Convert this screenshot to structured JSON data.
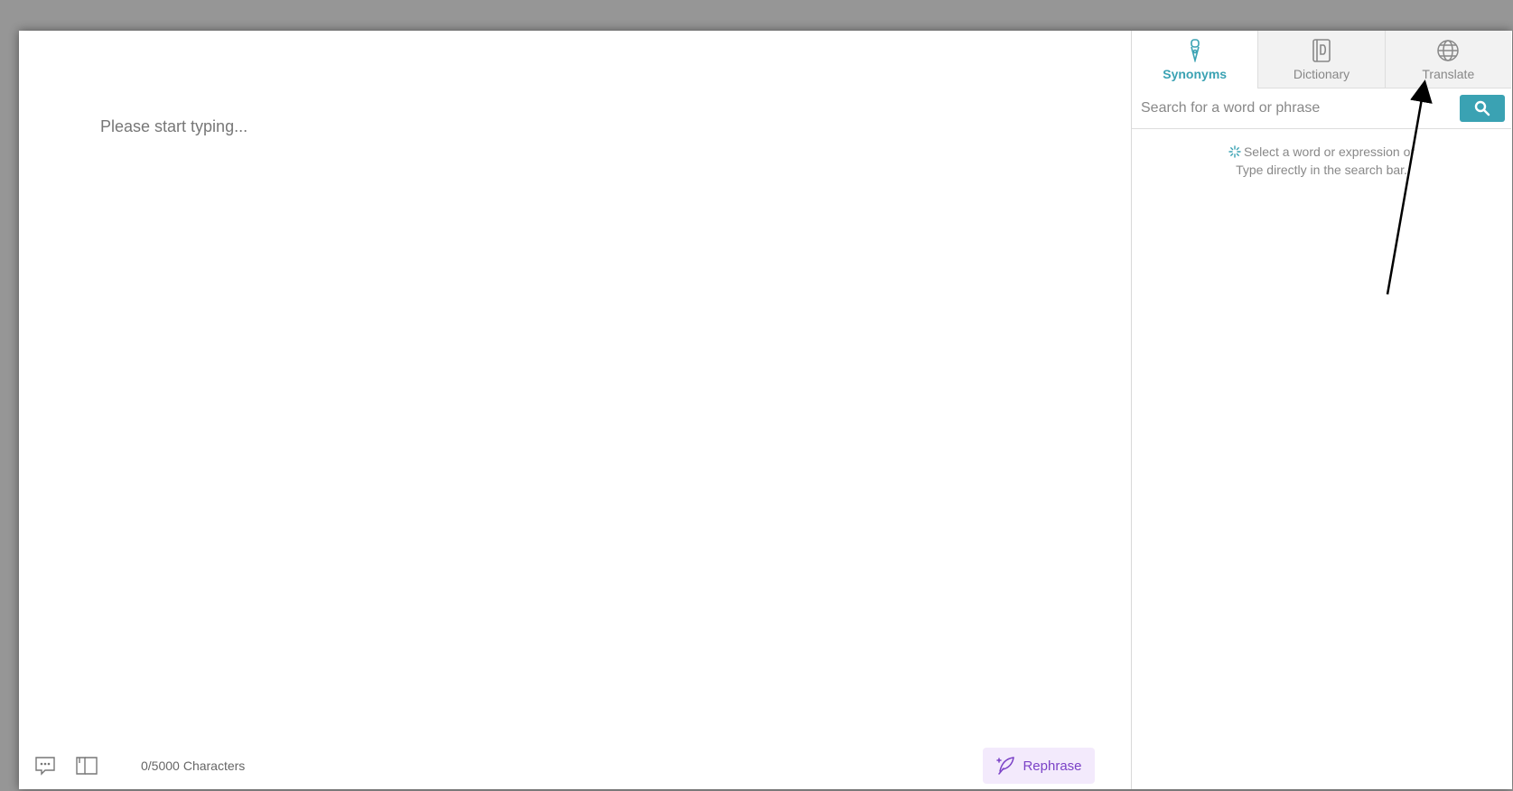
{
  "editor": {
    "placeholder": "Please start typing...",
    "char_count": "0/5000",
    "char_label": "Characters",
    "rephrase_label": "Rephrase"
  },
  "sidebar": {
    "tabs": [
      {
        "label": "Synonyms",
        "icon": "pen-nib-icon",
        "active": true
      },
      {
        "label": "Dictionary",
        "icon": "book-icon",
        "active": false
      },
      {
        "label": "Translate",
        "icon": "globe-icon",
        "active": false
      }
    ],
    "search": {
      "placeholder": "Search for a word or phrase",
      "value": ""
    },
    "hint": {
      "line1": "Select a word or expression or",
      "line2": "Type directly in the search bar."
    }
  },
  "colors": {
    "accent": "#3aa2b3",
    "rephrase_text": "#7b42c7",
    "rephrase_bg": "#f3eafc",
    "backdrop": "#969696"
  }
}
